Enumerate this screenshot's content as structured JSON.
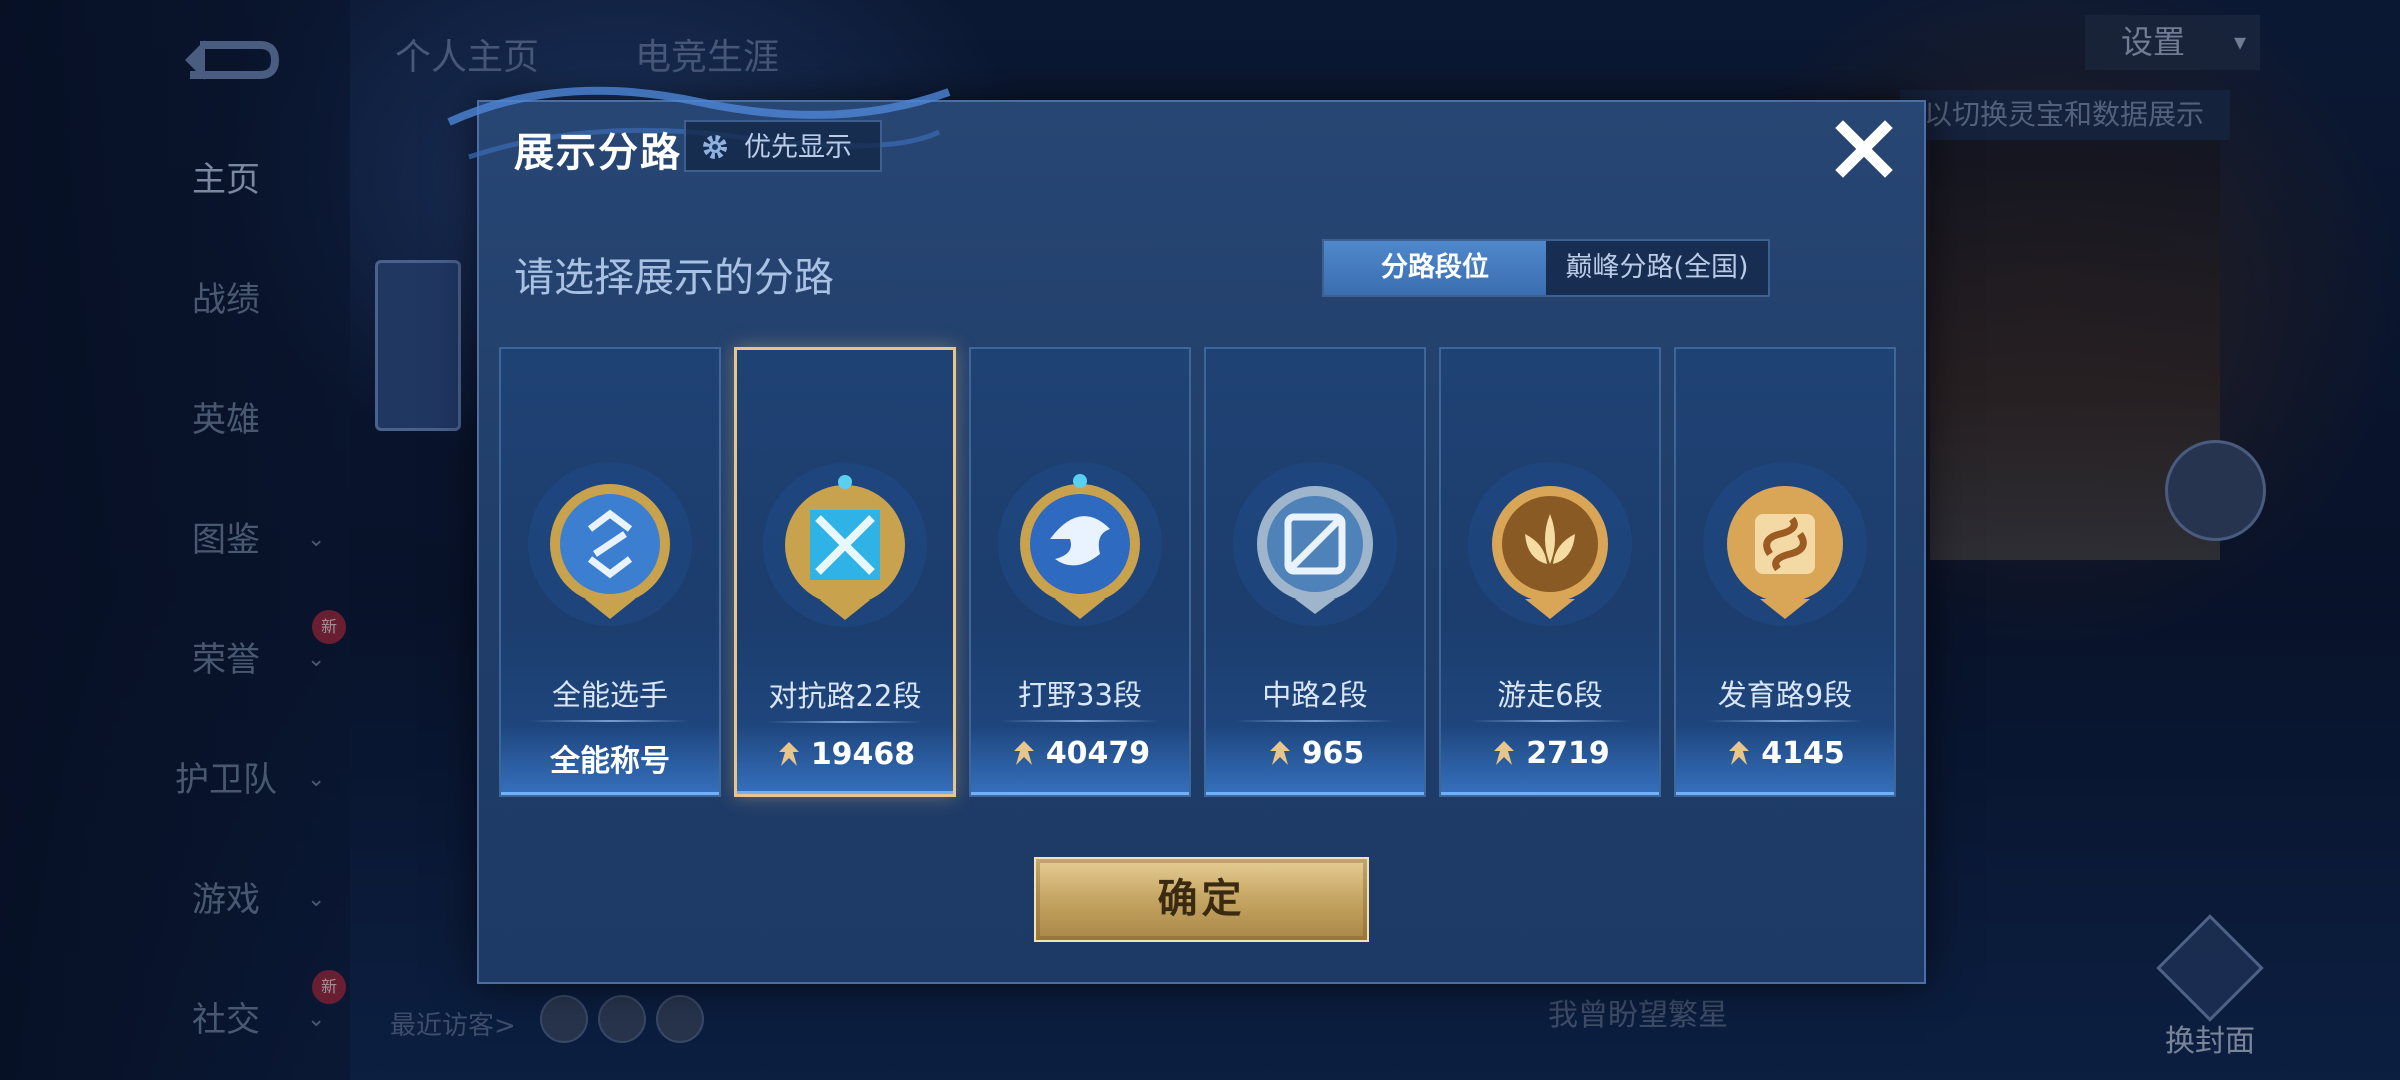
{
  "background": {
    "top_tabs": [
      "个人主页",
      "电竞生涯"
    ],
    "nav": [
      {
        "label": "主页",
        "active": true,
        "chevron": false,
        "new": false
      },
      {
        "label": "战绩",
        "active": false,
        "chevron": false,
        "new": false
      },
      {
        "label": "英雄",
        "active": false,
        "chevron": false,
        "new": false
      },
      {
        "label": "图鉴",
        "active": false,
        "chevron": true,
        "new": false
      },
      {
        "label": "荣誉",
        "active": false,
        "chevron": true,
        "new": true
      },
      {
        "label": "护卫队",
        "active": false,
        "chevron": true,
        "new": false
      },
      {
        "label": "游戏",
        "active": false,
        "chevron": true,
        "new": false
      },
      {
        "label": "社交",
        "active": false,
        "chevron": true,
        "new": true
      }
    ],
    "new_badge": "新",
    "settings_label": "设置",
    "hint_text": "以切换灵宝和数据展示",
    "visitors_label": "最近访客>",
    "tagline": "我曾盼望繁星",
    "cover_label": "换封面"
  },
  "modal": {
    "title": "展示分路",
    "priority_label": "优先显示",
    "subtitle": "请选择展示的分路",
    "segments": [
      "分路段位",
      "巅峰分路(全国)"
    ],
    "active_segment": 0,
    "cards": [
      {
        "name": "全能选手",
        "score": "全能称号",
        "has_icon": false,
        "selected": false,
        "emblem": "all-round",
        "color": "#4a86d6"
      },
      {
        "name": "对抗路22段",
        "score": "19468",
        "has_icon": true,
        "selected": true,
        "emblem": "clash-lane",
        "color": "#36b6e8"
      },
      {
        "name": "打野33段",
        "score": "40479",
        "has_icon": true,
        "selected": false,
        "emblem": "jungle",
        "color": "#3f7fd0"
      },
      {
        "name": "中路2段",
        "score": "965",
        "has_icon": true,
        "selected": false,
        "emblem": "mid-lane",
        "color": "#7aa0c8"
      },
      {
        "name": "游走6段",
        "score": "2719",
        "has_icon": true,
        "selected": false,
        "emblem": "roam",
        "color": "#c98a3c"
      },
      {
        "name": "发育路9段",
        "score": "4145",
        "has_icon": true,
        "selected": false,
        "emblem": "farm-lane",
        "color": "#d39a48"
      }
    ],
    "confirm_label": "确定"
  },
  "colors": {
    "modal_bg": "#284673",
    "selected_border": "#e8c58a",
    "gold_button": "#c8a866",
    "active_segment": "#4f88cc"
  }
}
